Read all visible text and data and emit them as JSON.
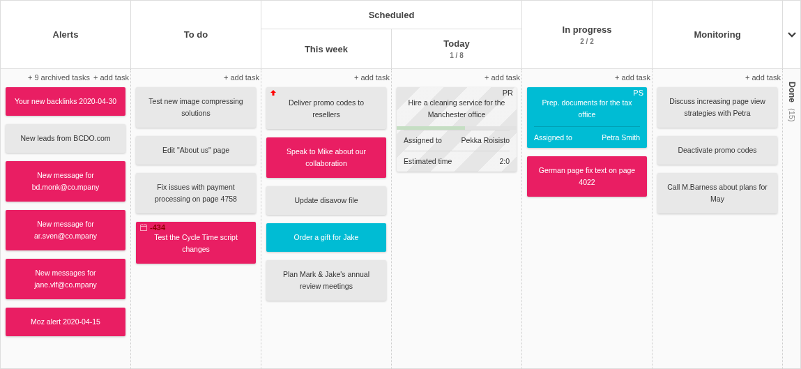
{
  "lanes": [
    {
      "title": "Alerts",
      "links": [
        "+ 9 archived tasks",
        "+ add task"
      ],
      "cards": [
        {
          "title": "Your new backlinks 2020-04-30",
          "color": "#e91e63",
          "striped": false
        },
        {
          "title": "New leads from BCDO.com",
          "color": "#e8e8e8",
          "striped": false
        },
        {
          "title": "New message for bd.monk@co.mpany",
          "color": "#e91e63",
          "striped": false
        },
        {
          "title": "New message for ar.sven@co.mpany",
          "color": "#e91e63",
          "striped": false
        },
        {
          "title": "New messages for jane.vlf@co.mpany",
          "color": "#e91e63",
          "striped": false
        },
        {
          "title": "Moz alert 2020-04-15",
          "color": "#e91e63",
          "striped": false
        }
      ]
    },
    {
      "title": "To do",
      "links": [
        "+ add task"
      ],
      "cards": [
        {
          "title": "Test new image compressing solutions",
          "color": "#e8e8e8",
          "striped": false
        },
        {
          "title": "Edit \"About us\" page",
          "color": "#e8e8e8",
          "striped": false
        },
        {
          "title": "Fix issues with payment processing on page 4758",
          "color": "#e8e8e8",
          "striped": false
        },
        {
          "title": "Test the Cycle Time script changes",
          "color": "#e91e63",
          "striped": false,
          "due": "-434"
        }
      ]
    },
    {
      "title": "Scheduled",
      "children": [
        {
          "title": "This week",
          "links": [
            "+ add task"
          ],
          "cards": [
            {
              "title": "Deliver promo codes to resellers",
              "color": "#e8e8e8",
              "striped": false,
              "flagged": true
            },
            {
              "title": "Speak to Mike about our collaboration",
              "color": "#e91e63",
              "striped": false
            },
            {
              "title": "Update disavow file",
              "color": "#e8e8e8",
              "striped": false
            },
            {
              "title": "Order a gift for Jake",
              "color": "#00bcd4",
              "striped": false
            },
            {
              "title": "Plan Mark & Jake's annual review meetings",
              "color": "#e8e8e8",
              "striped": false
            }
          ]
        },
        {
          "title": "Today",
          "count": "1 / 8",
          "links": [
            "+ add task"
          ],
          "cards": [
            {
              "title": "Hire a cleaning service for the Manchester office",
              "color": "#e6e6e6",
              "striped": true,
              "initials": "PR",
              "level": 0.57,
              "fields": [
                {
                  "label": "Assigned to",
                  "value": "Pekka Roisisto"
                },
                {
                  "label": "Estimated time",
                  "value": "2:0"
                }
              ]
            }
          ]
        }
      ]
    },
    {
      "title": "In progress",
      "count": "2 / 2",
      "links": [
        "+ add task"
      ],
      "cards": [
        {
          "title": "Prep. documents for the tax office",
          "color": "#00bcd4",
          "striped": false,
          "initials": "PS",
          "fields": [
            {
              "label": "Assigned to",
              "value": "Petra Smith"
            }
          ]
        },
        {
          "title": "German page fix text on page 4022",
          "color": "#e91e63",
          "striped": false
        }
      ]
    },
    {
      "title": "Monitoring",
      "links": [
        "+ add task"
      ],
      "cards": [
        {
          "title": "Discuss increasing page view strategies with Petra",
          "color": "#e8e8e8",
          "striped": false
        },
        {
          "title": "Deactivate promo codes",
          "color": "#e8e8e8",
          "striped": false
        },
        {
          "title": "Call M.Barness about plans for May",
          "color": "#e8e8e8",
          "striped": false
        }
      ]
    },
    {
      "title": "Done",
      "count": "(15)",
      "collapsed": true
    }
  ]
}
